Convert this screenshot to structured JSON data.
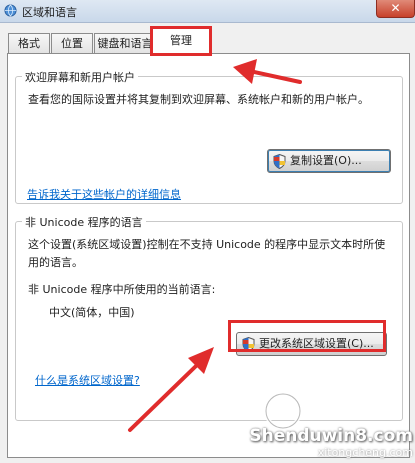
{
  "window": {
    "title": "区域和语言",
    "close_symbol": "✕"
  },
  "tabs": [
    {
      "label": "格式"
    },
    {
      "label": "位置"
    },
    {
      "label": "键盘和语言"
    },
    {
      "label": "管理"
    }
  ],
  "welcome_group": {
    "title": "欢迎屏幕和新用户帐户",
    "description": "查看您的国际设置并将其复制到欢迎屏幕、系统帐户和新的用户帐户。",
    "copy_button": "复制设置(O)...",
    "details_link": "告诉我关于这些帐户的详细信息"
  },
  "unicode_group": {
    "title": "非 Unicode 程序的语言",
    "description": "这个设置(系统区域设置)控制在不支持 Unicode 的程序中显示文本时所使用的语言。",
    "current_language_label": "非 Unicode 程序中所使用的当前语言:",
    "current_language_value": "中文(简体，中国)",
    "change_button": "更改系统区域设置(C)...",
    "help_link": "什么是系统区域设置?"
  },
  "watermark": {
    "text": "Shenduwin8.com",
    "sub": "xitongcheng.com"
  },
  "colors": {
    "annotation": "#e02c2c",
    "link": "#0066cc"
  }
}
